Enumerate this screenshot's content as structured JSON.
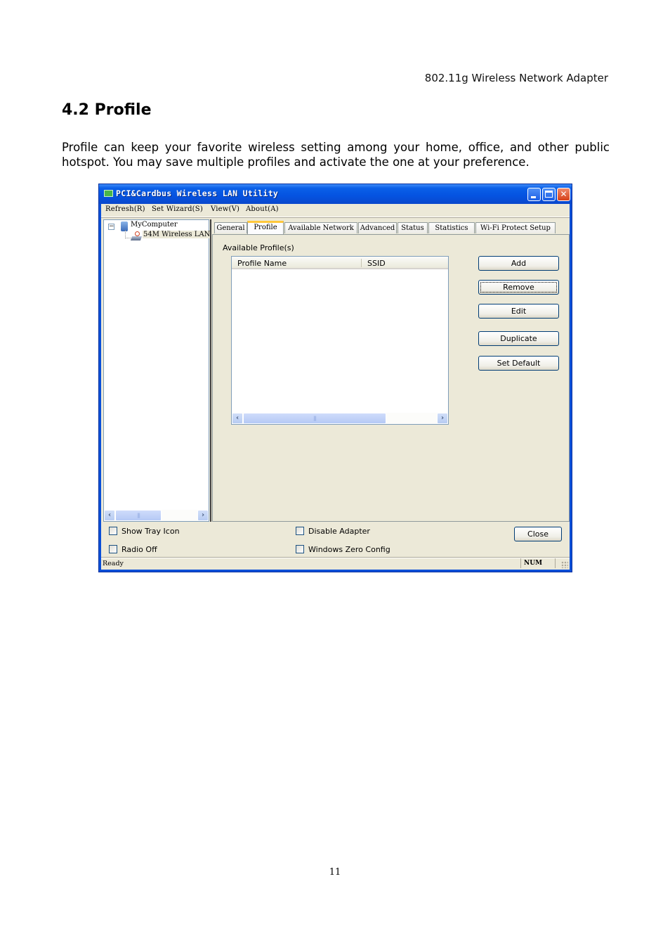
{
  "document": {
    "header": "802.11g Wireless Network Adapter",
    "section_title": "4.2 Profile",
    "paragraph": "Profile can keep your favorite wireless setting among your home, office, and other public hotspot. You may save multiple profiles and activate the one at your preference.",
    "page_number": "11"
  },
  "window": {
    "title": "PCI&Cardbus Wireless LAN Utility",
    "controls": {
      "minimize": "minimize",
      "maximize": "maximize",
      "close": "✕"
    },
    "menu": [
      {
        "label": "Refresh(R)"
      },
      {
        "label": "Set Wizard(S)"
      },
      {
        "label": "View(V)"
      },
      {
        "label": "About(A)"
      }
    ],
    "tree": {
      "root": {
        "label": "MyComputer",
        "expander": "−",
        "icon": "computer-icon"
      },
      "child": {
        "label": "54M Wireless LAN",
        "icon": "wireless-adapter-icon"
      }
    },
    "tabs": [
      {
        "label": "General"
      },
      {
        "label": "Profile",
        "active": true
      },
      {
        "label": "Available Network"
      },
      {
        "label": "Advanced"
      },
      {
        "label": "Status"
      },
      {
        "label": "Statistics"
      },
      {
        "label": "Wi-Fi Protect Setup"
      }
    ],
    "profile_tab": {
      "group_label": "Available Profile(s)",
      "columns": [
        "Profile Name",
        "SSID"
      ],
      "rows": [],
      "buttons": {
        "add": "Add",
        "remove": "Remove",
        "edit": "Edit",
        "duplicate": "Duplicate",
        "set_default": "Set Default"
      },
      "focused_button": "remove"
    },
    "scroll_arrows": {
      "left": "‹",
      "right": "›",
      "grip": "|||"
    },
    "options": {
      "show_tray_icon": {
        "label": "Show Tray Icon",
        "checked": false
      },
      "radio_off": {
        "label": "Radio Off",
        "checked": false
      },
      "disable_adapter": {
        "label": "Disable Adapter",
        "checked": false
      },
      "windows_zero_config": {
        "label": "Windows Zero Config",
        "checked": false
      }
    },
    "close_button": "Close",
    "status": {
      "text": "Ready",
      "num": "NUM"
    }
  }
}
